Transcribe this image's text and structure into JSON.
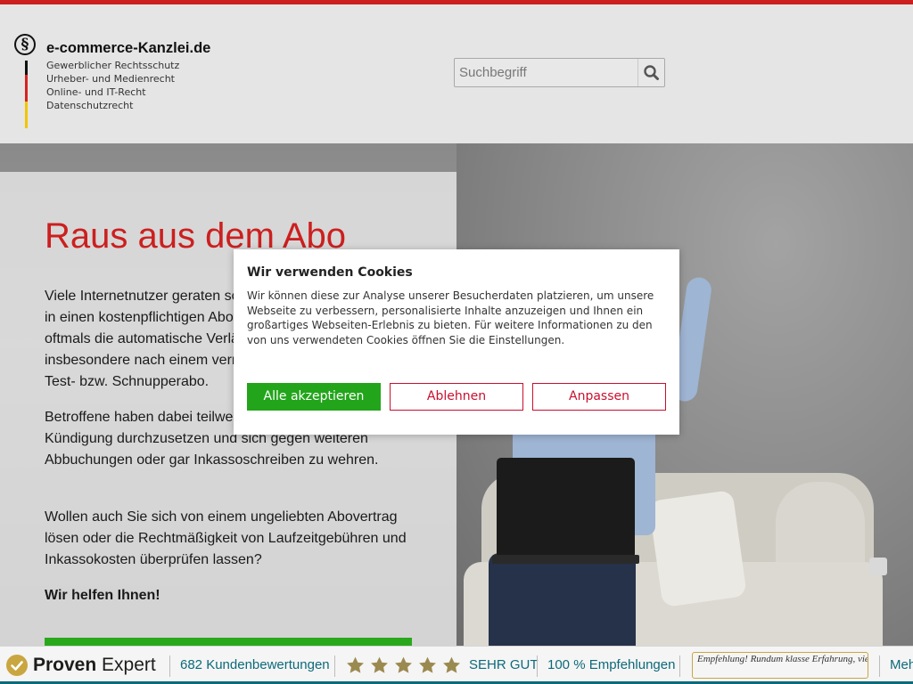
{
  "header": {
    "logo_symbol": "§",
    "site_name": "e-commerce-Kanzlei.de",
    "tagline_lines": [
      "Gewerblicher Rechtsschutz",
      "Urheber- und Medienrecht",
      "Online- und IT-Recht",
      "Datenschutzrecht"
    ],
    "search": {
      "placeholder": "Suchbegriff",
      "value": ""
    }
  },
  "hero": {
    "title": "Raus aus dem Abo",
    "paragraphs": [
      "Viele Internetnutzer geraten schnell – und meist ungewollt – in einen kostenpflichtigen Abovertrag. Die Krux ist hier oftmals die automatische Verlängerung des Vertrags insbesondere nach einem vermeintlich kostengünstigen Test- bzw. Schnupperabo.",
      "Betroffene haben dabei teilweise Schwierigkeiten und eine Kündigung durchzusetzen und sich gegen weiteren Abbuchungen oder gar Inkassoschreiben zu wehren.",
      "Wollen auch Sie sich von einem ungeliebten Abovertrag lösen oder die Rechtmäßigkeit von Laufzeitgebühren und Inkassokosten überprüfen lassen?",
      "Wir helfen Ihnen!"
    ]
  },
  "cookie_banner": {
    "title": "Wir verwenden Cookies",
    "text": "Wir können diese zur Analyse unserer Besucherdaten platzieren, um unsere Webseite zu verbessern, personalisierte Inhalte anzuzeigen und Ihnen ein großartiges Webseiten-Erlebnis zu bieten. Für weitere Informationen zu den von uns verwendeten Cookies öffnen Sie die Einstellungen.",
    "buttons": {
      "accept": "Alle akzeptieren",
      "decline": "Ablehnen",
      "customize": "Anpassen"
    }
  },
  "proven_expert": {
    "brand_bold": "Proven",
    "brand_light": "Expert",
    "reviews": "682 Kundenbewertungen",
    "stars": 5,
    "rating": "SEHR GUT",
    "recommend": "100 % Empfehlungen",
    "quote": "Empfehlung! Rundum klasse Erfahrung, vielen Dank! Hr. Günnewig",
    "more": "Meh"
  },
  "colors": {
    "accent_red": "#cc1f1f",
    "accept_green": "#22a51a",
    "button_red": "#c8102e",
    "pe_teal": "#0c6a7a",
    "pe_gold": "#c9a640"
  }
}
